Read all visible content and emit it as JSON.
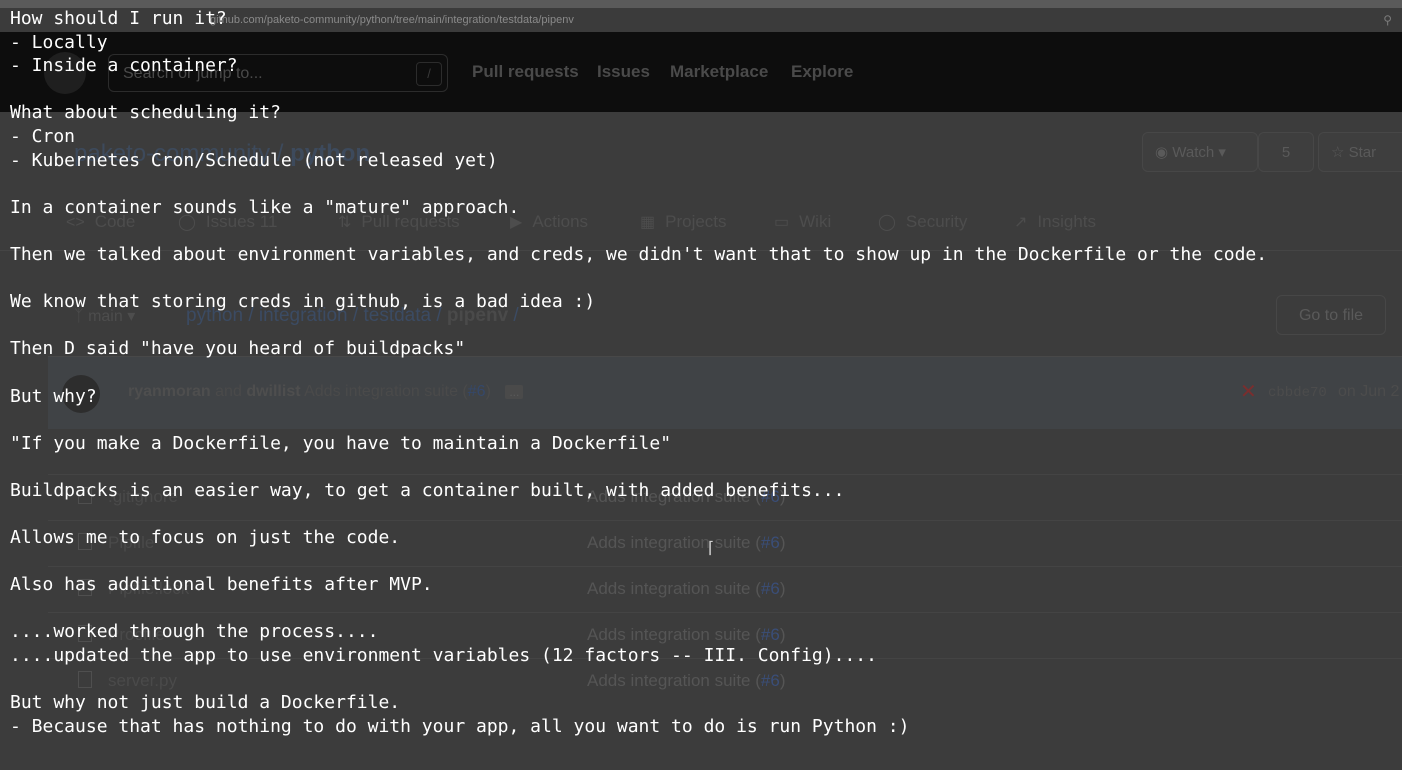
{
  "browser": {
    "url": "github.com/paketo-community/python/tree/main/integration/testdata/pipenv",
    "zoom_icon": "magnifier-icon"
  },
  "github": {
    "search_placeholder": "Search or jump to...",
    "slash_key": "/",
    "nav": [
      "Pull requests",
      "Issues",
      "Marketplace",
      "Explore"
    ],
    "repo_owner": "paketo-community",
    "repo_sep": " / ",
    "repo_name": "python",
    "watch_label": "Watch",
    "watch_count": "5",
    "star_label": "Star",
    "tabs": [
      {
        "label": "Code",
        "icon": "code-icon"
      },
      {
        "label": "Issues",
        "icon": "issue-icon",
        "count": "11"
      },
      {
        "label": "Pull requests",
        "icon": "pr-icon"
      },
      {
        "label": "Actions",
        "icon": "play-icon"
      },
      {
        "label": "Projects",
        "icon": "project-icon"
      },
      {
        "label": "Wiki",
        "icon": "book-icon"
      },
      {
        "label": "Security",
        "icon": "shield-icon"
      },
      {
        "label": "Insights",
        "icon": "graph-icon"
      }
    ],
    "branch": "main",
    "breadcrumb": [
      "python",
      "integration",
      "testdata",
      "pipenv"
    ],
    "go_to_file": "Go to file",
    "commit": {
      "author1": "ryanmoran",
      "and": "and",
      "author2": "dwillist",
      "message": "Adds integration suite (",
      "pr": "#6",
      "close": ")",
      "ellipsis": "...",
      "sha": "cbbde70",
      "date": "on Jun 2"
    },
    "files": [
      {
        "name": ".gitignore",
        "message": "Adds integration suite (",
        "pr": "#6"
      },
      {
        "name": "Pipfile",
        "message": "Adds integration suite (",
        "pr": "#6"
      },
      {
        "name": "Pipfile.lock",
        "message": "Adds integration suite (",
        "pr": "#6"
      },
      {
        "name": "Procfile",
        "message": "Adds integration suite (",
        "pr": "#6"
      },
      {
        "name": "server.py",
        "message": "Adds integration suite (",
        "pr": "#6"
      }
    ]
  },
  "terminal": {
    "lines": [
      "How should I run it?",
      "- Locally",
      "- Inside a container?",
      "",
      "What about scheduling it?",
      "- Cron",
      "- Kubernetes Cron/Schedule (not released yet)",
      "",
      "In a container sounds like a \"mature\" approach.",
      "",
      "Then we talked about environment variables, and creds, we didn't want that to show up in the Dockerfile or the code.",
      "",
      "We know that storing creds in github, is a bad idea :)",
      "",
      "Then D said \"have you heard of buildpacks\"",
      "",
      "But why?",
      "",
      "\"If you make a Dockerfile, you have to maintain a Dockerfile\"",
      "",
      "Buildpacks is an easier way, to get a container built, with added benefits...",
      "",
      "Allows me to focus on just the code.",
      "",
      "Also has additional benefits after MVP.",
      "",
      "....worked through the process....",
      "....updated the app to use environment variables (12 factors -- III. Config)....",
      "",
      "But why not just build a Dockerfile.",
      "- Because that has nothing to do with your app, all you want to do is run Python :)"
    ]
  }
}
